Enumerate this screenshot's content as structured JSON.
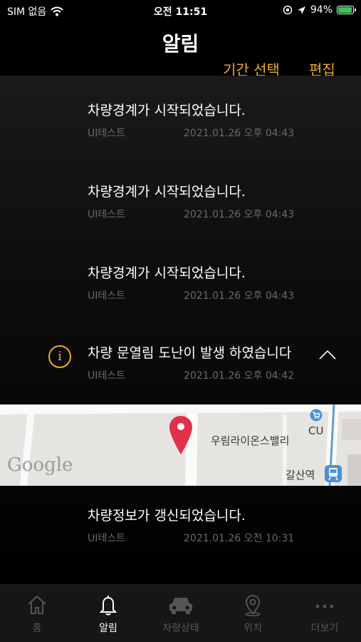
{
  "status_bar": {
    "carrier": "SIM 없음",
    "time": "오전 11:51",
    "battery": "94%",
    "battery_level": 0.94
  },
  "header": {
    "title": "알림",
    "period_select_label": "기간 선택",
    "edit_label": "편집"
  },
  "notifications": [
    {
      "message": "차량경계가 시작되었습니다.",
      "source": "UI테스트",
      "datetime": "2021.01.26  오후 04:43"
    },
    {
      "message": "차량경계가 시작되었습니다.",
      "source": "UI테스트",
      "datetime": "2021.01.26  오후 04:43"
    },
    {
      "message": "차량경계가 시작되었습니다.",
      "source": "UI테스트",
      "datetime": "2021.01.26  오후 04:43"
    },
    {
      "message": "차량 문열림 도난이 발생 하였습니다",
      "source": "UI테스트",
      "datetime": "2021.01.26  오후 04:42",
      "expanded": true,
      "icon": "info-icon"
    },
    {
      "message": "차량정보가 갱신되었습니다.",
      "source": "UI테스트",
      "datetime": "2021.01.26  오전 10:31"
    }
  ],
  "map": {
    "place_label": "우림라이온스밸리",
    "store_label": "CU",
    "station_label": "갈산역",
    "google_logo": "Google"
  },
  "tabbar": {
    "items": [
      {
        "label": "홈",
        "icon": "home-icon",
        "active": false
      },
      {
        "label": "알림",
        "icon": "bell-icon",
        "active": true
      },
      {
        "label": "차량상태",
        "icon": "car-icon",
        "active": false
      },
      {
        "label": "위치",
        "icon": "location-pin-icon",
        "active": false
      },
      {
        "label": "더보기",
        "icon": "more-icon",
        "active": false
      }
    ]
  },
  "colors": {
    "accent": "#f0a830",
    "pin": "#e0304a",
    "background": "#000000"
  }
}
